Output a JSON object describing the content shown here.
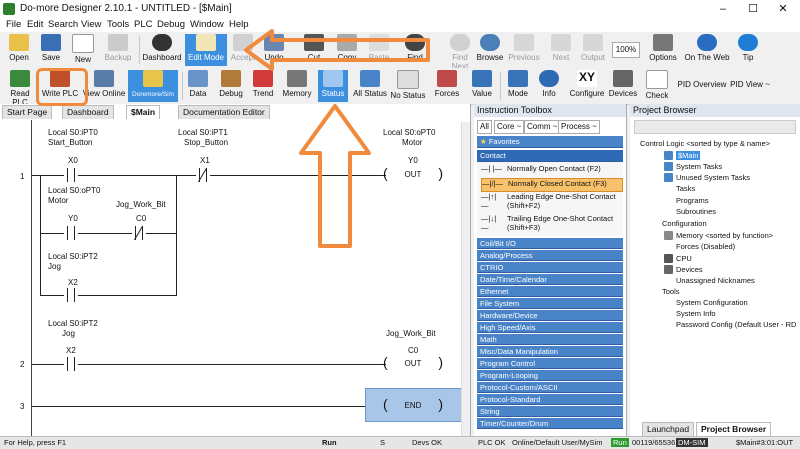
{
  "window": {
    "title": "Do-more Designer 2.10.1 - UNTITLED - [$Main]",
    "controls": [
      "–",
      "☐",
      "✕"
    ]
  },
  "menu": [
    "File",
    "Edit",
    "Search",
    "View",
    "Tools",
    "PLC",
    "Debug",
    "Window",
    "Help"
  ],
  "toolbar1": [
    {
      "label": "Open"
    },
    {
      "label": "Save"
    },
    {
      "label": "New"
    },
    {
      "label": "Backup"
    },
    {
      "label": "Dashboard"
    },
    {
      "label": "Edit Mode"
    },
    {
      "label": "Accept"
    },
    {
      "label": "Undo"
    },
    {
      "label": "Cut"
    },
    {
      "label": "Copy"
    },
    {
      "label": "Paste"
    },
    {
      "label": "Find"
    },
    {
      "label": "Find Next"
    },
    {
      "label": "Browse"
    },
    {
      "label": "Previous"
    },
    {
      "label": "Next"
    },
    {
      "label": "Output"
    },
    {
      "label": "100%"
    },
    {
      "label": "Options"
    },
    {
      "label": "On The Web"
    },
    {
      "label": "Tip"
    }
  ],
  "toolbar2": [
    {
      "label": "Read PLC"
    },
    {
      "label": "Write PLC"
    },
    {
      "label": "View Online"
    },
    {
      "label": "Doremore/Sim"
    },
    {
      "label": "Data"
    },
    {
      "label": "Debug"
    },
    {
      "label": "Trend"
    },
    {
      "label": "Memory"
    },
    {
      "label": "Status"
    },
    {
      "label": "All Status"
    },
    {
      "label": "No Status"
    },
    {
      "label": "Forces"
    },
    {
      "label": "Value"
    },
    {
      "label": "Mode"
    },
    {
      "label": "Info"
    },
    {
      "label": "Configure"
    },
    {
      "label": "Devices"
    },
    {
      "label": "Check"
    },
    {
      "label": "PID Overview"
    },
    {
      "label": "PID View ~"
    }
  ],
  "ladder": {
    "tabs": [
      "Start Page",
      "Dashboard",
      "$Main",
      "Documentation Editor"
    ],
    "rungs": {
      "r1": {
        "num": "1",
        "x0_nick": "Local S0:iPT0",
        "x0_name": "Start_Button",
        "x0_addr": "X0",
        "x1_nick": "Local S0:iPT1",
        "x1_name": "Stop_Button",
        "x1_addr": "X1",
        "y0_nick": "Local S0:oPT0",
        "y0_name": "Motor",
        "y0_addr": "Y0",
        "y0_op": "OUT",
        "b1_nick": "Local S0:oPT0",
        "b1_name": "Motor",
        "b1_addr": "Y0",
        "b1c_name": "Jog_Work_Bit",
        "b1c_addr": "C0",
        "b2_nick": "Local S0:iPT2",
        "b2_name": "Jog",
        "b2_addr": "X2"
      },
      "r2": {
        "num": "2",
        "c_nick": "Local S0:iPT2",
        "c_name": "Jog",
        "c_addr": "X2",
        "coil_name": "Jog_Work_Bit",
        "coil_addr": "C0",
        "coil_op": "OUT"
      },
      "r3": {
        "num": "3",
        "op": "END"
      }
    }
  },
  "toolbox": {
    "title": "Instruction Toolbox",
    "filters": [
      "All",
      "Core ~",
      "Comm ~",
      "Process ~"
    ],
    "favorites": "Favorites",
    "contact": "Contact",
    "items": [
      "Normally Open Contact (F2)",
      "Normally Closed Contact (F3)",
      "Leading Edge One-Shot Contact (Shift+F2)",
      "Trailing Edge One-Shot Contact (Shift+F3)"
    ],
    "categories": [
      "Coil/Bit I/O",
      "Analog/Process",
      "CTRIO",
      "Date/Time/Calendar",
      "Ethernet",
      "File System",
      "Hardware/Device",
      "High Speed/Axis",
      "Math",
      "Misc/Data Manipulation",
      "Program Control",
      "Program-Looping",
      "Protocol-Custom/ASCII",
      "Protocol-Standard",
      "String",
      "Timer/Counter/Drum"
    ]
  },
  "project": {
    "title": "Project Browser",
    "items": [
      "Control Logic <sorted by type & name>",
      "$Main",
      "System Tasks",
      "Unused System Tasks",
      "Tasks",
      "Programs",
      "Subroutines",
      "Configuration",
      "Memory <sorted by function>",
      "Forces (Disabled)",
      "CPU",
      "Devices",
      "Unassigned Nicknames",
      "Tools",
      "System Configuration",
      "System Info",
      "Password Config (Default User - RD W"
    ],
    "bottom_tabs": [
      "Launchpad",
      "Project Browser"
    ]
  },
  "status": {
    "help": "For Help, press F1",
    "run": "Run",
    "s": "S",
    "devs": "Devs OK",
    "plc": "PLC OK",
    "user": "Online/Default User/MySim",
    "mode": "Run",
    "scan": "00119/65536",
    "sim": "DM-SIM",
    "pos": "$Main#3:01:OUT"
  },
  "colors": {
    "highlight_orange": "#f08a3c",
    "toolbox_blue": "#4a84c8",
    "selected_blue": "#3d8fe0"
  }
}
